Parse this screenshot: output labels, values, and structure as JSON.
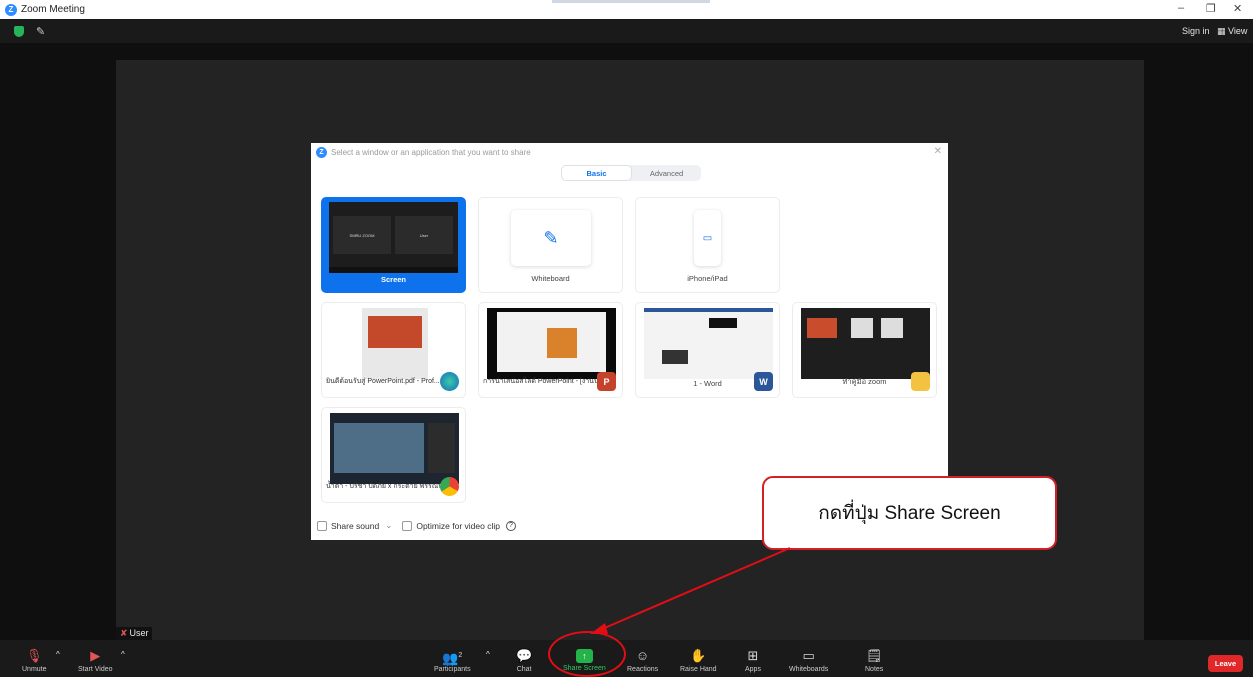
{
  "window": {
    "title": "Zoom Meeting",
    "controls": {
      "minimize": "–",
      "restore": "❐",
      "close": "✕"
    }
  },
  "topbar": {
    "sign_in": "Sign in",
    "view": "View"
  },
  "participant": {
    "name": "User"
  },
  "share_dialog": {
    "prompt": "Select a window or an application that you want to share",
    "tabs": [
      {
        "label": "Basic",
        "active": true
      },
      {
        "label": "Advanced",
        "active": false
      }
    ],
    "tiles": [
      {
        "label": "Screen",
        "selected": true,
        "thumb_text_left": "SMRU ZOOM",
        "thumb_text_right": "User"
      },
      {
        "label": "Whiteboard",
        "selected": false
      },
      {
        "label": "iPhone/iPad",
        "selected": false
      },
      {
        "label": "ยินดีต้อนรับสู่ PowerPoint.pdf - Prof...",
        "app": "edge-icon"
      },
      {
        "label": "การนำเสนอสไลด์ PowerPoint - [งานน...",
        "app": "powerpoint-icon",
        "app_letter": "P"
      },
      {
        "label": "1 - Word",
        "app": "word-icon",
        "app_letter": "W"
      },
      {
        "label": "ทำคู่มือ zoom",
        "app": "folder-icon"
      },
      {
        "label": "น้ำตา - ปรีชา ปัดภัย x กระต่าย พรรณนิ...",
        "app": "chrome-icon"
      }
    ],
    "footer": {
      "share_sound": "Share sound",
      "share_sound_caret": "⌄",
      "optimize": "Optimize for video clip",
      "help": "?"
    }
  },
  "callout": {
    "text": "กดที่ปุ่ม Share Screen",
    "border_color": "#d32027"
  },
  "toolbar": {
    "unmute": "Unmute",
    "start_video": "Start Video",
    "participants": "Participants",
    "participant_count": "2",
    "chat": "Chat",
    "share_screen": "Share Screen",
    "reactions": "Reactions",
    "raise_hand": "Raise Hand",
    "apps": "Apps",
    "whiteboards": "Whiteboards",
    "notes": "Notes",
    "leave": "Leave",
    "caret": "^"
  },
  "colors": {
    "accent": "#0e72ed",
    "share_green": "#23b34a",
    "leave_red": "#e02828",
    "annotation_red": "#e30d16"
  }
}
